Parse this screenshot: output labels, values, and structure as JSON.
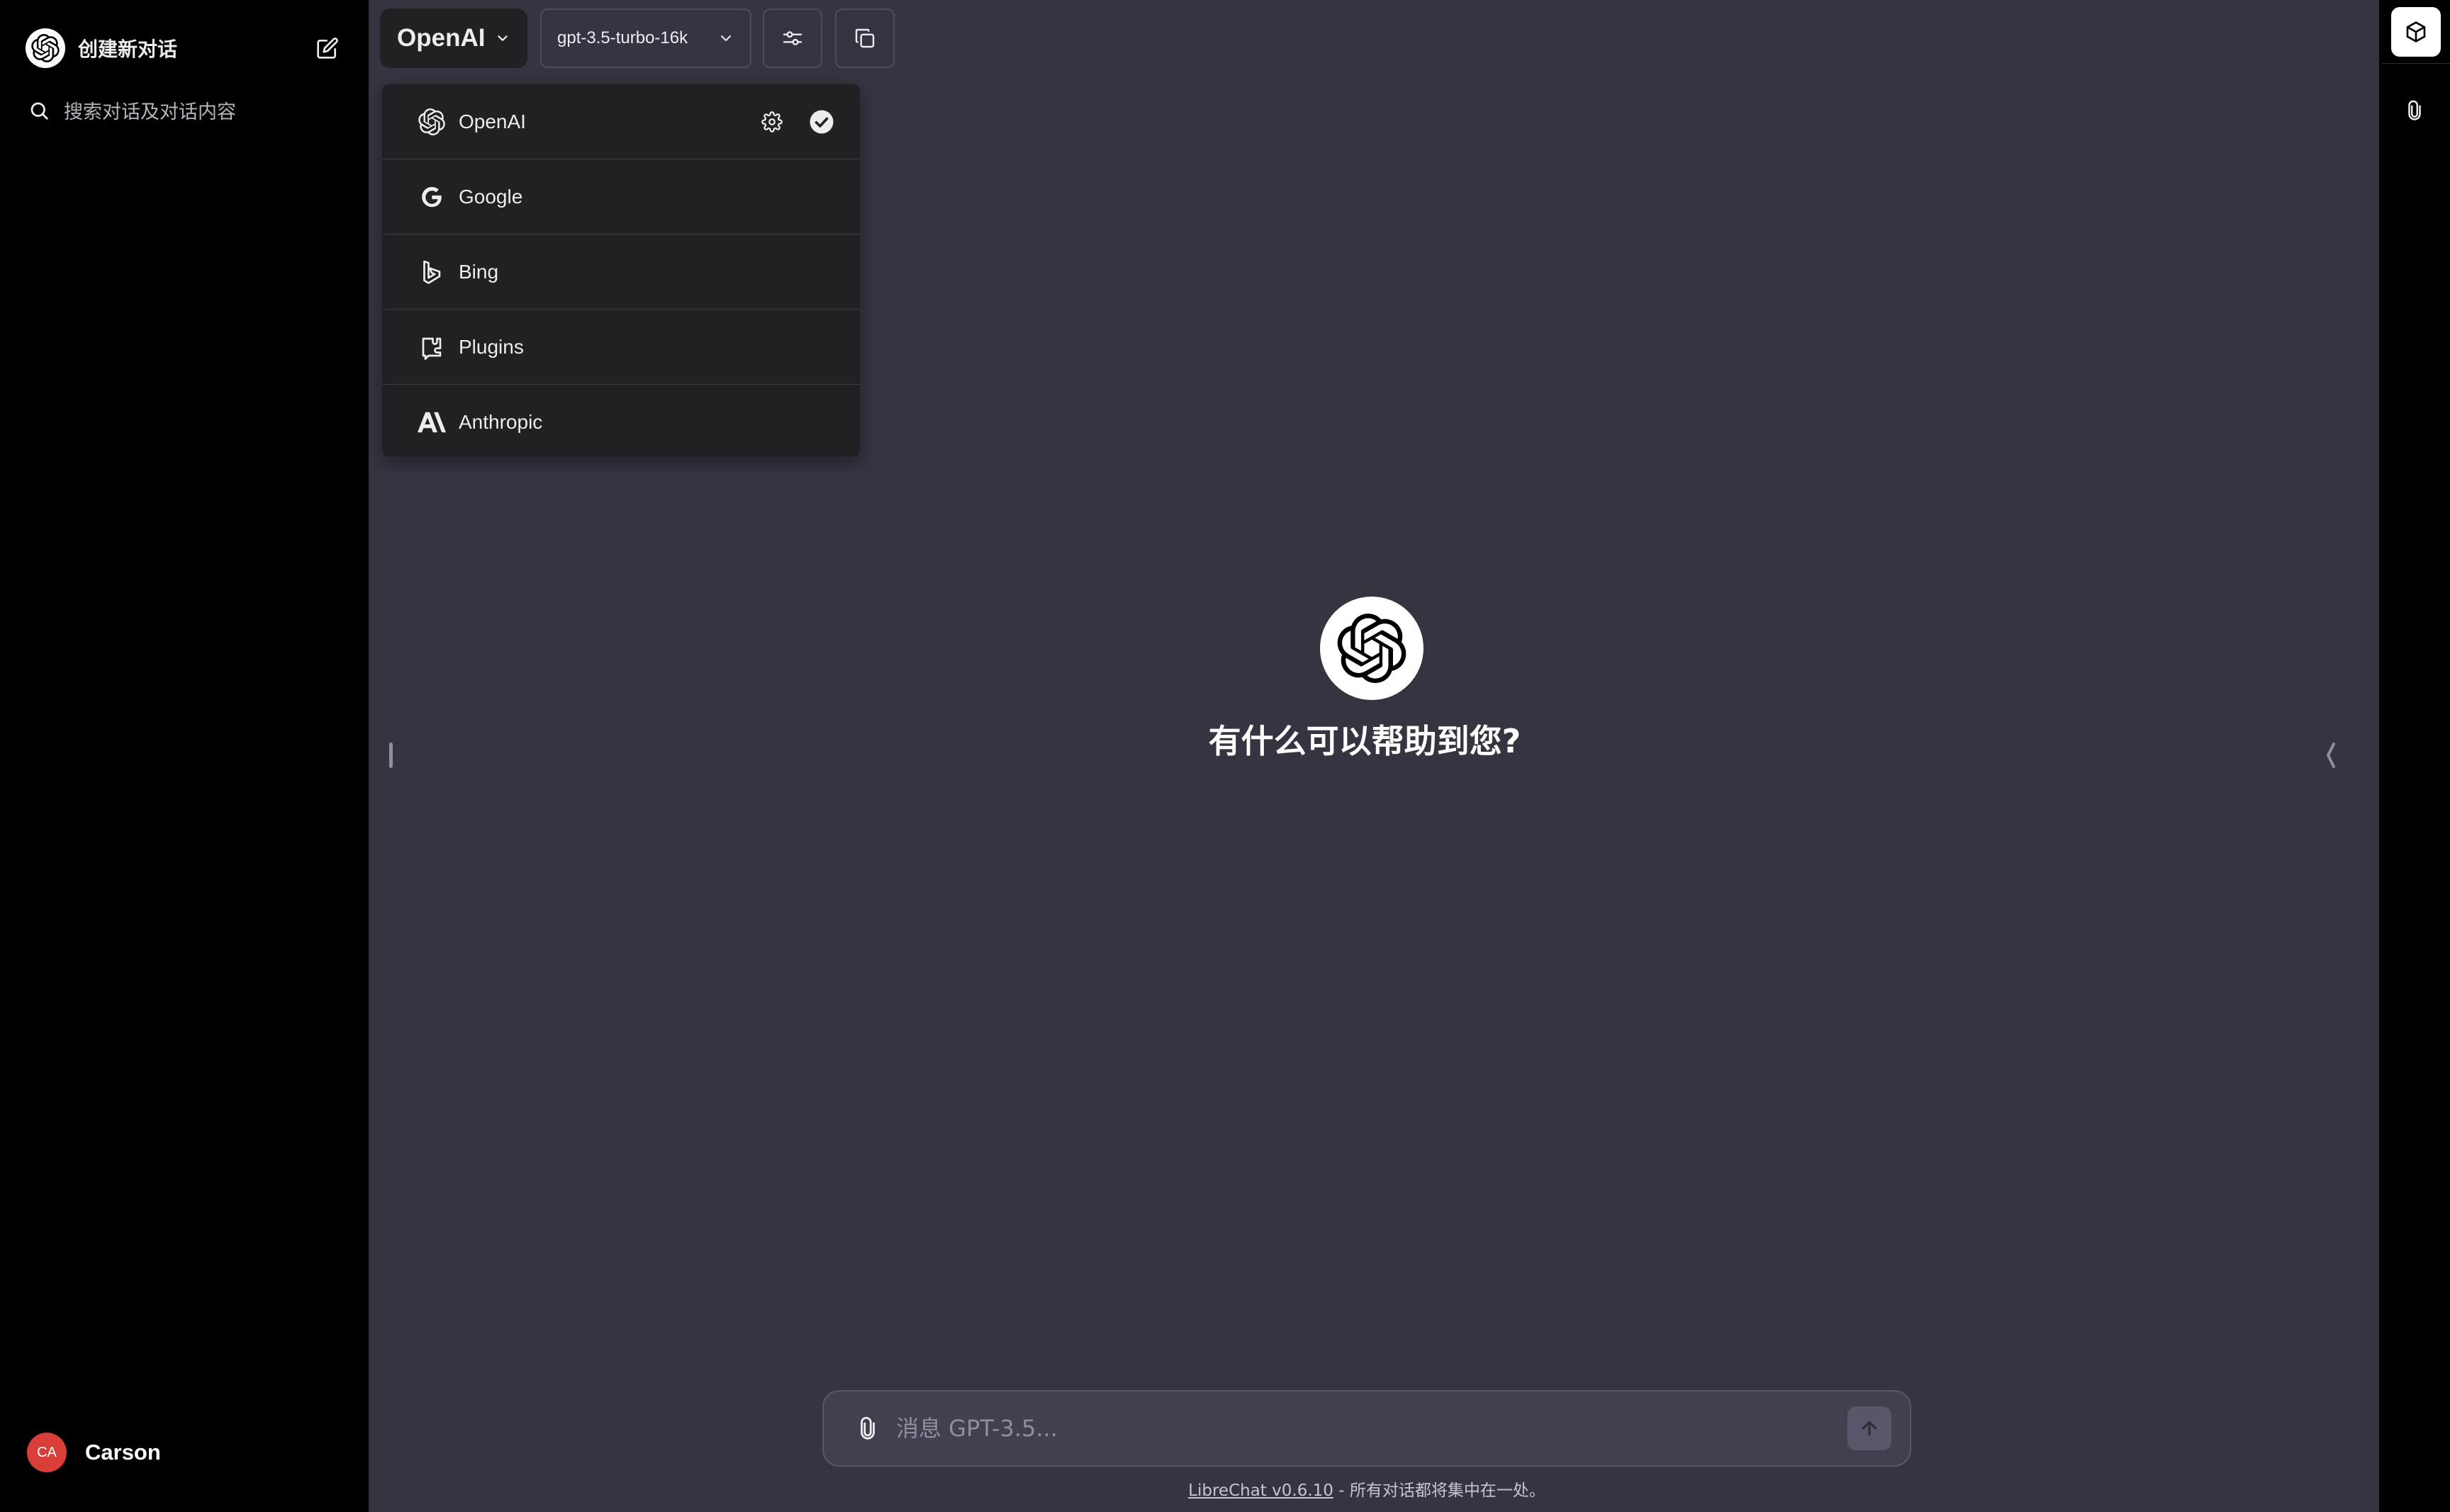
{
  "sidebar": {
    "new_chat_label": "创建新对话",
    "search_placeholder": "搜索对话及对话内容",
    "user": {
      "initials": "CA",
      "name": "Carson"
    }
  },
  "topbar": {
    "endpoint_label": "OpenAI",
    "model_label": "gpt-3.5-turbo-16k"
  },
  "dropdown": {
    "items": [
      {
        "label": "OpenAI",
        "icon": "openai-icon",
        "selected": true
      },
      {
        "label": "Google",
        "icon": "google-icon",
        "selected": false
      },
      {
        "label": "Bing",
        "icon": "bing-icon",
        "selected": false
      },
      {
        "label": "Plugins",
        "icon": "plugins-icon",
        "selected": false
      },
      {
        "label": "Anthropic",
        "icon": "anthropic-icon",
        "selected": false
      }
    ]
  },
  "main": {
    "greeting": "有什么可以帮助到您?"
  },
  "composer": {
    "placeholder": "消息 GPT-3.5..."
  },
  "footer": {
    "link_text": "LibreChat v0.6.10",
    "suffix": " - 所有对话都将集中在一处。"
  },
  "colors": {
    "sidebar_bg": "#000000",
    "main_bg": "#343541",
    "dropdown_bg": "#202123",
    "avatar_bg": "#d93f38"
  }
}
